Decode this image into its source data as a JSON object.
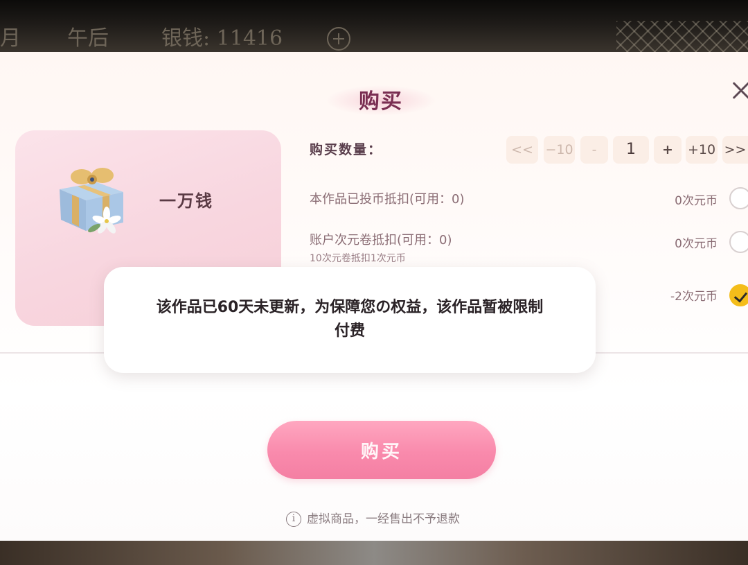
{
  "topbar": {
    "month_fragment": "月",
    "time_of_day": "午后",
    "silver_label": "银钱: 11416",
    "add_icon": "plus-circle-icon"
  },
  "dialog": {
    "title": "购买",
    "close_icon": "close-icon",
    "product": {
      "name": "一万钱",
      "icon": "gift-box-icon"
    },
    "quantity": {
      "label": "购买数量：",
      "first_label": "<<",
      "minus10_label": "−10",
      "minus_label": "-",
      "value": "1",
      "plus_label": "+",
      "plus10_label": "+10",
      "last_label": ">>"
    },
    "deductions": [
      {
        "label": "本作品已投币抵扣(可用：0)",
        "value": "0次元币",
        "checked": false
      },
      {
        "label": "账户次元卷抵扣(可用：0)",
        "sub": "10次元卷抵扣1次元币",
        "value": "0次元币",
        "checked": false
      },
      {
        "label": "",
        "value": "-2次元币",
        "checked": true
      }
    ],
    "buy_button": "购买",
    "notice": "虚拟商品，一经售出不予退款",
    "notice_icon": "info-icon"
  },
  "toast": {
    "line1": "该作品已60天未更新，为保障您の权益，该作品暂被限制",
    "line2": "付费"
  },
  "colors": {
    "accent_pink": "#f98aac",
    "title_color": "#7a2e52",
    "checked_yellow": "#f4bd1a"
  }
}
